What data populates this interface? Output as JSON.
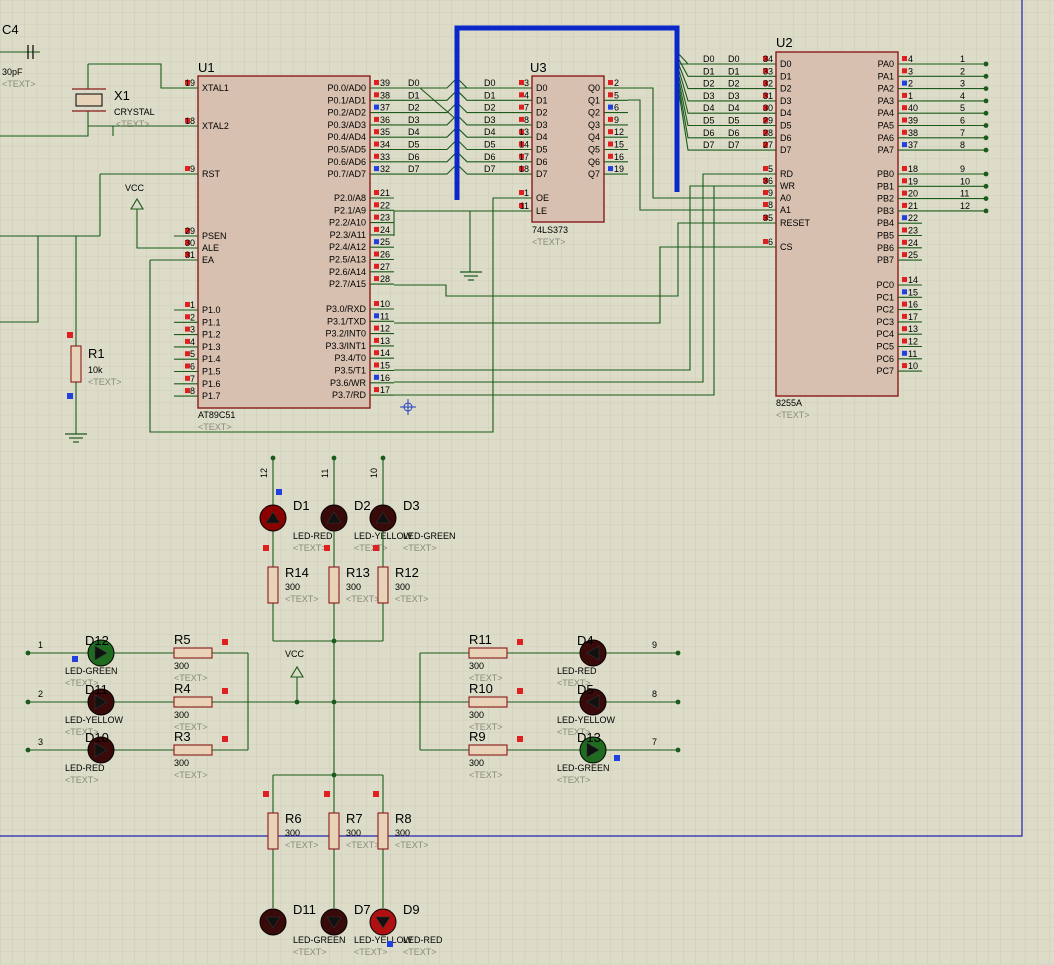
{
  "u1": {
    "ref": "U1",
    "part": "AT89C51",
    "text": "<TEXT>",
    "left_pins": [
      {
        "n": "19",
        "name": "XTAL1"
      },
      {
        "n": "18",
        "name": "XTAL2"
      },
      {
        "n": "9",
        "name": "RST"
      },
      {
        "n": "29",
        "name": "PSEN"
      },
      {
        "n": "30",
        "name": "ALE"
      },
      {
        "n": "31",
        "name": "EA"
      },
      {
        "n": "1",
        "name": "P1.0"
      },
      {
        "n": "2",
        "name": "P1.1"
      },
      {
        "n": "3",
        "name": "P1.2"
      },
      {
        "n": "4",
        "name": "P1.3"
      },
      {
        "n": "5",
        "name": "P1.4"
      },
      {
        "n": "6",
        "name": "P1.5"
      },
      {
        "n": "7",
        "name": "P1.6"
      },
      {
        "n": "8",
        "name": "P1.7"
      }
    ],
    "right_pins": [
      {
        "n": "39",
        "name": "P0.0/AD0",
        "net": "D0"
      },
      {
        "n": "38",
        "name": "P0.1/AD1",
        "net": "D1"
      },
      {
        "n": "37",
        "name": "P0.2/AD2",
        "net": "D2"
      },
      {
        "n": "36",
        "name": "P0.3/AD3",
        "net": "D3"
      },
      {
        "n": "35",
        "name": "P0.4/AD4",
        "net": "D4"
      },
      {
        "n": "34",
        "name": "P0.5/AD5",
        "net": "D5"
      },
      {
        "n": "33",
        "name": "P0.6/AD6",
        "net": "D6"
      },
      {
        "n": "32",
        "name": "P0.7/AD7",
        "net": "D7"
      },
      {
        "n": "21",
        "name": "P2.0/A8"
      },
      {
        "n": "22",
        "name": "P2.1/A9"
      },
      {
        "n": "23",
        "name": "P2.2/A10"
      },
      {
        "n": "24",
        "name": "P2.3/A11"
      },
      {
        "n": "25",
        "name": "P2.4/A12"
      },
      {
        "n": "26",
        "name": "P2.5/A13"
      },
      {
        "n": "27",
        "name": "P2.6/A14"
      },
      {
        "n": "28",
        "name": "P2.7/A15"
      },
      {
        "n": "10",
        "name": "P3.0/RXD"
      },
      {
        "n": "11",
        "name": "P3.1/TXD"
      },
      {
        "n": "12",
        "name": "P3.2/INT0"
      },
      {
        "n": "13",
        "name": "P3.3/INT1"
      },
      {
        "n": "14",
        "name": "P3.4/T0"
      },
      {
        "n": "15",
        "name": "P3.5/T1"
      },
      {
        "n": "16",
        "name": "P3.6/WR"
      },
      {
        "n": "17",
        "name": "P3.7/RD"
      }
    ]
  },
  "u3": {
    "ref": "U3",
    "part": "74LS373",
    "text": "<TEXT>",
    "left_pins": [
      {
        "n": "3",
        "name": "D0",
        "net": "D0"
      },
      {
        "n": "4",
        "name": "D1",
        "net": "D1"
      },
      {
        "n": "7",
        "name": "D2",
        "net": "D2"
      },
      {
        "n": "8",
        "name": "D3",
        "net": "D3"
      },
      {
        "n": "13",
        "name": "D4",
        "net": "D4"
      },
      {
        "n": "14",
        "name": "D5",
        "net": "D5"
      },
      {
        "n": "17",
        "name": "D6",
        "net": "D6"
      },
      {
        "n": "18",
        "name": "D7",
        "net": "D7"
      },
      {
        "n": "1",
        "name": "OE"
      },
      {
        "n": "11",
        "name": "LE"
      }
    ],
    "right_pins": [
      {
        "n": "2",
        "name": "Q0"
      },
      {
        "n": "5",
        "name": "Q1"
      },
      {
        "n": "6",
        "name": "Q2"
      },
      {
        "n": "9",
        "name": "Q3"
      },
      {
        "n": "12",
        "name": "Q4"
      },
      {
        "n": "15",
        "name": "Q5"
      },
      {
        "n": "16",
        "name": "Q6"
      },
      {
        "n": "19",
        "name": "Q7"
      }
    ]
  },
  "u2": {
    "ref": "U2",
    "part": "8255A",
    "text": "<TEXT>",
    "left_pins": [
      {
        "n": "34",
        "name": "D0",
        "net": "D0"
      },
      {
        "n": "33",
        "name": "D1",
        "net": "D1"
      },
      {
        "n": "32",
        "name": "D2",
        "net": "D2"
      },
      {
        "n": "31",
        "name": "D3",
        "net": "D3"
      },
      {
        "n": "30",
        "name": "D4",
        "net": "D4"
      },
      {
        "n": "29",
        "name": "D5",
        "net": "D5"
      },
      {
        "n": "28",
        "name": "D6",
        "net": "D6"
      },
      {
        "n": "27",
        "name": "D7",
        "net": "D7"
      },
      {
        "n": "5",
        "name": "RD"
      },
      {
        "n": "36",
        "name": "WR"
      },
      {
        "n": "9",
        "name": "A0"
      },
      {
        "n": "8",
        "name": "A1"
      },
      {
        "n": "35",
        "name": "RESET"
      },
      {
        "n": "6",
        "name": "CS"
      }
    ],
    "right_pins": [
      {
        "n": "4",
        "name": "PA0",
        "net": "1"
      },
      {
        "n": "3",
        "name": "PA1",
        "net": "2"
      },
      {
        "n": "2",
        "name": "PA2",
        "net": "3"
      },
      {
        "n": "1",
        "name": "PA3",
        "net": "4"
      },
      {
        "n": "40",
        "name": "PA4",
        "net": "5"
      },
      {
        "n": "39",
        "name": "PA5",
        "net": "6"
      },
      {
        "n": "38",
        "name": "PA6",
        "net": "7"
      },
      {
        "n": "37",
        "name": "PA7",
        "net": "8"
      },
      {
        "n": "18",
        "name": "PB0",
        "net": "9"
      },
      {
        "n": "19",
        "name": "PB1",
        "net": "10"
      },
      {
        "n": "20",
        "name": "PB2",
        "net": "11"
      },
      {
        "n": "21",
        "name": "PB3",
        "net": "12"
      },
      {
        "n": "22",
        "name": "PB4"
      },
      {
        "n": "23",
        "name": "PB5"
      },
      {
        "n": "24",
        "name": "PB6"
      },
      {
        "n": "25",
        "name": "PB7"
      },
      {
        "n": "14",
        "name": "PC0"
      },
      {
        "n": "15",
        "name": "PC1"
      },
      {
        "n": "16",
        "name": "PC2"
      },
      {
        "n": "17",
        "name": "PC3"
      },
      {
        "n": "13",
        "name": "PC4"
      },
      {
        "n": "12",
        "name": "PC5"
      },
      {
        "n": "11",
        "name": "PC6"
      },
      {
        "n": "10",
        "name": "PC7"
      }
    ]
  },
  "c4": {
    "ref": "C4",
    "value": "30pF",
    "text": "<TEXT>"
  },
  "x1": {
    "ref": "X1",
    "value": "CRYSTAL",
    "text": "<TEXT>"
  },
  "r1": {
    "ref": "R1",
    "value": "10k",
    "text": "<TEXT>"
  },
  "vcc_label": "VCC",
  "resistors": [
    {
      "ref": "R14",
      "value": "300"
    },
    {
      "ref": "R13",
      "value": "300"
    },
    {
      "ref": "R12",
      "value": "300"
    },
    {
      "ref": "R5",
      "value": "300"
    },
    {
      "ref": "R4",
      "value": "300"
    },
    {
      "ref": "R3",
      "value": "300"
    },
    {
      "ref": "R11",
      "value": "300"
    },
    {
      "ref": "R10",
      "value": "300"
    },
    {
      "ref": "R9",
      "value": "300"
    },
    {
      "ref": "R6",
      "value": "300"
    },
    {
      "ref": "R7",
      "value": "300"
    },
    {
      "ref": "R8",
      "value": "300"
    }
  ],
  "leds": [
    {
      "ref": "D1",
      "type": "LED-RED",
      "color": "#8b0000"
    },
    {
      "ref": "D2",
      "type": "LED-YELLOW",
      "color": "#3a0a0a"
    },
    {
      "ref": "D3",
      "type": "LED-GREEN",
      "color": "#3a0a0a"
    },
    {
      "ref": "D12",
      "type": "LED-GREEN",
      "color": "#1f6b1f"
    },
    {
      "ref": "D11",
      "type": "LED-YELLOW",
      "color": "#3a0a0a"
    },
    {
      "ref": "D10",
      "type": "LED-RED",
      "color": "#3a0a0a"
    },
    {
      "ref": "D4",
      "type": "LED-RED",
      "color": "#3a0a0a"
    },
    {
      "ref": "D5",
      "type": "LED-YELLOW",
      "color": "#3a0a0a"
    },
    {
      "ref": "D13",
      "type": "LED-GREEN",
      "color": "#1f6b1f"
    },
    {
      "ref": "D11",
      "type": "LED-GREEN",
      "color": "#3a0a0a"
    },
    {
      "ref": "D7",
      "type": "LED-YELLOW",
      "color": "#3a0a0a"
    },
    {
      "ref": "D9",
      "type": "LED-RED",
      "color": "#b01010"
    }
  ],
  "net_labels": {
    "top": [
      "12",
      "11",
      "10"
    ],
    "left": [
      "1",
      "2",
      "3"
    ],
    "right": [
      "9",
      "8",
      "7"
    ]
  },
  "colors": {
    "background": "#dcdcc8",
    "wire": "#1a5a1a",
    "bus": "#0a28c8",
    "chip_fill": "#d7c0b0",
    "chip_border": "#8b1a1a",
    "sheet_border": "#2222aa"
  }
}
